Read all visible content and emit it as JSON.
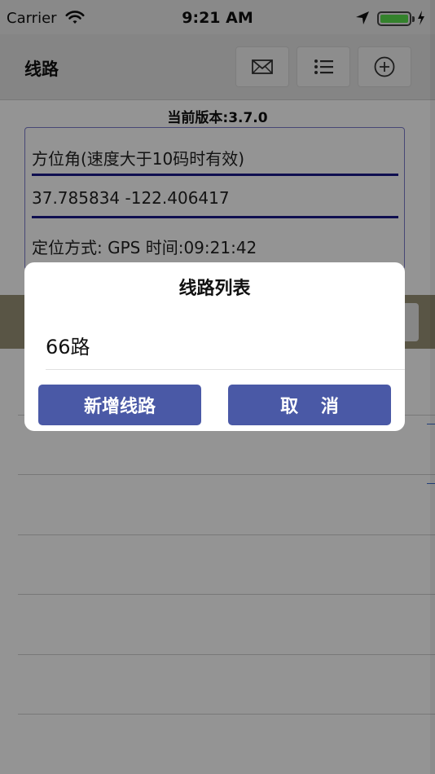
{
  "status_bar": {
    "carrier": "Carrier",
    "time": "9:21 AM",
    "battery_level": 1.0,
    "icons": [
      "wifi-icon",
      "location-arrow-icon",
      "battery-icon",
      "charging-bolt-icon"
    ]
  },
  "nav": {
    "title": "线路",
    "buttons": [
      "mail-icon",
      "list-icon",
      "add-circle-icon"
    ]
  },
  "version_text": "当前版本:3.7.0",
  "info": {
    "heading": "方位角(速度大于10码时有效)",
    "coordinates": "37.785834  -122.406417",
    "location_line": "定位方式: GPS 时间:09:21:42"
  },
  "dialog": {
    "title": "线路列表",
    "items": [
      "66路"
    ],
    "add_label": "新增线路",
    "cancel_label": "取 消"
  },
  "colors": {
    "dialog_button": "#4a59a6",
    "info_line": "#1a1a8a",
    "battery": "#5be04c"
  }
}
